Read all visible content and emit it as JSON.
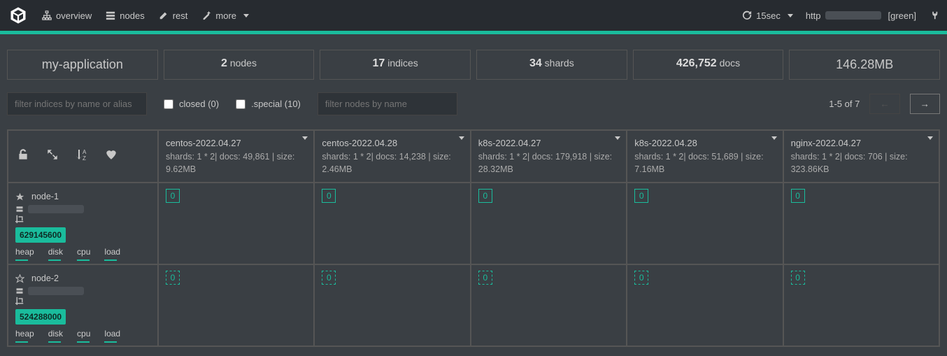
{
  "nav": {
    "overview": "overview",
    "nodes": "nodes",
    "rest": "rest",
    "more": "more",
    "refresh": "15sec",
    "url_prefix": "http",
    "status": "[green]"
  },
  "summary": {
    "app": "my-application",
    "nodes_count": "2",
    "nodes_label": "nodes",
    "indices_count": "17",
    "indices_label": "indices",
    "shards_count": "34",
    "shards_label": "shards",
    "docs_count": "426,752",
    "docs_label": "docs",
    "size": "146.28MB"
  },
  "filters": {
    "index_placeholder": "filter indices by name or alias",
    "closed": "closed (0)",
    "special": ".special (10)",
    "node_placeholder": "filter nodes by name",
    "page_info": "1-5 of 7",
    "prev": "←",
    "next": "→"
  },
  "indices": [
    {
      "name": "centos-2022.04.27",
      "meta": "shards: 1 * 2| docs: 49,861 | size: 9.62MB"
    },
    {
      "name": "centos-2022.04.28",
      "meta": "shards: 1 * 2| docs: 14,238 | size: 2.46MB"
    },
    {
      "name": "k8s-2022.04.27",
      "meta": "shards: 1 * 2| docs: 179,918 | size: 28.32MB"
    },
    {
      "name": "k8s-2022.04.28",
      "meta": "shards: 1 * 2| docs: 51,689 | size: 7.16MB"
    },
    {
      "name": "nginx-2022.04.27",
      "meta": "shards: 1 * 2| docs: 706 | size: 323.86KB"
    }
  ],
  "nodes_rows": [
    {
      "name": "node-1",
      "badge": "629145600",
      "primary": true
    },
    {
      "name": "node-2",
      "badge": "524288000",
      "primary": false
    }
  ],
  "node_metrics": [
    "heap",
    "disk",
    "cpu",
    "load"
  ],
  "shard_label": "0"
}
